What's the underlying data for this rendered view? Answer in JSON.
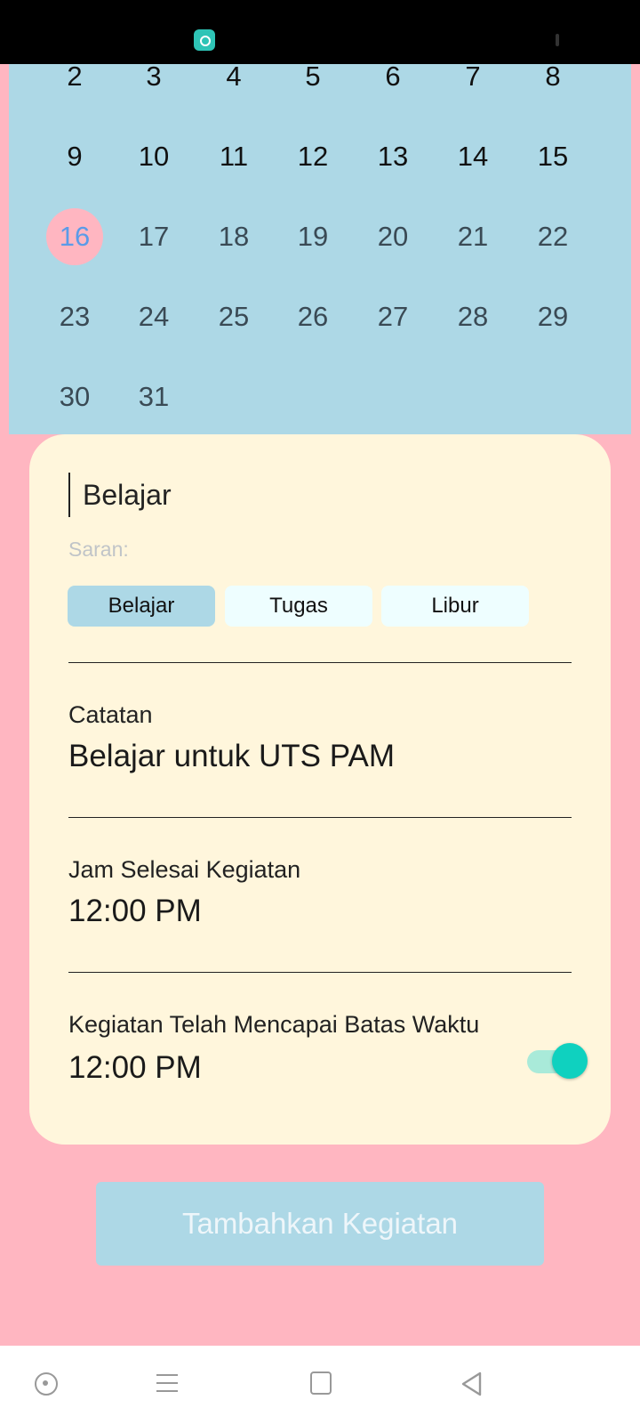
{
  "status_bar": {
    "icons": [
      "app-notification-icon",
      "status-indicator-icon"
    ]
  },
  "calendar": {
    "selected_day": "16",
    "rows": [
      [
        "2",
        "3",
        "4",
        "5",
        "6",
        "7",
        "8"
      ],
      [
        "9",
        "10",
        "11",
        "12",
        "13",
        "14",
        "15"
      ],
      [
        "16",
        "17",
        "18",
        "19",
        "20",
        "21",
        "22"
      ],
      [
        "23",
        "24",
        "25",
        "26",
        "27",
        "28",
        "29"
      ],
      [
        "30",
        "31"
      ]
    ]
  },
  "form": {
    "title_value": "Belajar",
    "suggestions_label": "Saran:",
    "suggestions": [
      {
        "label": "Belajar",
        "active": true
      },
      {
        "label": "Tugas",
        "active": false
      },
      {
        "label": "Libur",
        "active": false
      }
    ],
    "note_label": "Catatan",
    "note_value": "Belajar untuk UTS PAM",
    "end_time_label": "Jam Selesai Kegiatan",
    "end_time_value": "12:00 PM",
    "deadline_label": "Kegiatan Telah Mencapai Batas Waktu",
    "deadline_value": "12:00 PM",
    "deadline_toggle_on": true
  },
  "submit_button": {
    "label": "Tambahkan Kegiatan"
  },
  "nav_bar": {
    "icons": [
      "home-circle-icon",
      "menu-icon",
      "recent-apps-icon",
      "back-icon"
    ]
  },
  "colors": {
    "background": "#ffb6c1",
    "calendar_bg": "#add8e6",
    "card_bg": "#fff6dc",
    "selected_day_text": "#5b9be8",
    "toggle_accent": "#0fd1bf"
  }
}
